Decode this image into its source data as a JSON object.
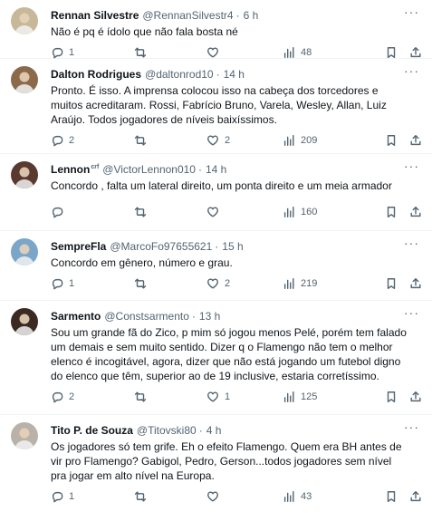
{
  "tweets": [
    {
      "name": "Rennan Silvestre",
      "handle": "@RennanSilvestr4",
      "time": "6 h",
      "text": "Não é pq é ídolo que não fala bosta né",
      "replies": "1",
      "retweets": "",
      "likes": "",
      "views": "48",
      "avatar_bg": "#c8b89a"
    },
    {
      "name": "Dalton Rodrigues",
      "handle": "@daltonrod10",
      "time": "14 h",
      "text": "Pronto. É isso. A imprensa colocou isso na cabeça dos torcedores e muitos acreditaram. Rossi, Fabrício Bruno, Varela, Wesley, Allan, Luiz Araújo. Todos jogadores de níveis baixíssimos.",
      "replies": "2",
      "retweets": "",
      "likes": "2",
      "views": "209",
      "avatar_bg": "#8a6a4a"
    },
    {
      "name": "Lennon",
      "name_sup": "crf",
      "handle": "@VictorLennon010",
      "time": "14 h",
      "text": "Concordo , falta um lateral direito, um ponta direito e um meia armador",
      "replies": "",
      "retweets": "",
      "likes": "",
      "views": "160",
      "avatar_bg": "#5a3a2e"
    },
    {
      "name": "SempreFla",
      "handle": "@MarcoFo97655621",
      "time": "15 h",
      "text": "Concordo em gênero, número e grau.",
      "replies": "1",
      "retweets": "",
      "likes": "2",
      "views": "219",
      "avatar_bg": "#7aa6c9"
    },
    {
      "name": "Sarmento",
      "handle": "@Constsarmento",
      "time": "13 h",
      "text": "Sou um grande fã do Zico, p mim só jogou menos Pelé, porém tem falado um demais e sem muito sentido. Dizer q o Flamengo não tem o melhor elenco é incogitável, agora, dizer que não está jogando um futebol digno do elenco que têm, superior ao de 19 inclusive, estaria corretíssimo.",
      "replies": "2",
      "retweets": "",
      "likes": "1",
      "views": "125",
      "avatar_bg": "#3a2a22"
    },
    {
      "name": "Tito P. de Souza",
      "handle": "@Titovski80",
      "time": "4 h",
      "text": "Os jogadores só tem grife. Eh o efeito Flamengo. Quem era BH antes de vir pro Flamengo? Gabigol, Pedro, Gerson...todos jogadores sem nível pra jogar em alto nível na Europa.",
      "replies": "1",
      "retweets": "",
      "likes": "",
      "views": "43",
      "avatar_bg": "#b9b2a8"
    }
  ],
  "icons": {
    "reply": "reply-icon",
    "retweet": "retweet-icon",
    "like": "heart-icon",
    "views": "views-icon",
    "bookmark": "bookmark-icon",
    "share": "share-icon",
    "more": "more-icon"
  }
}
